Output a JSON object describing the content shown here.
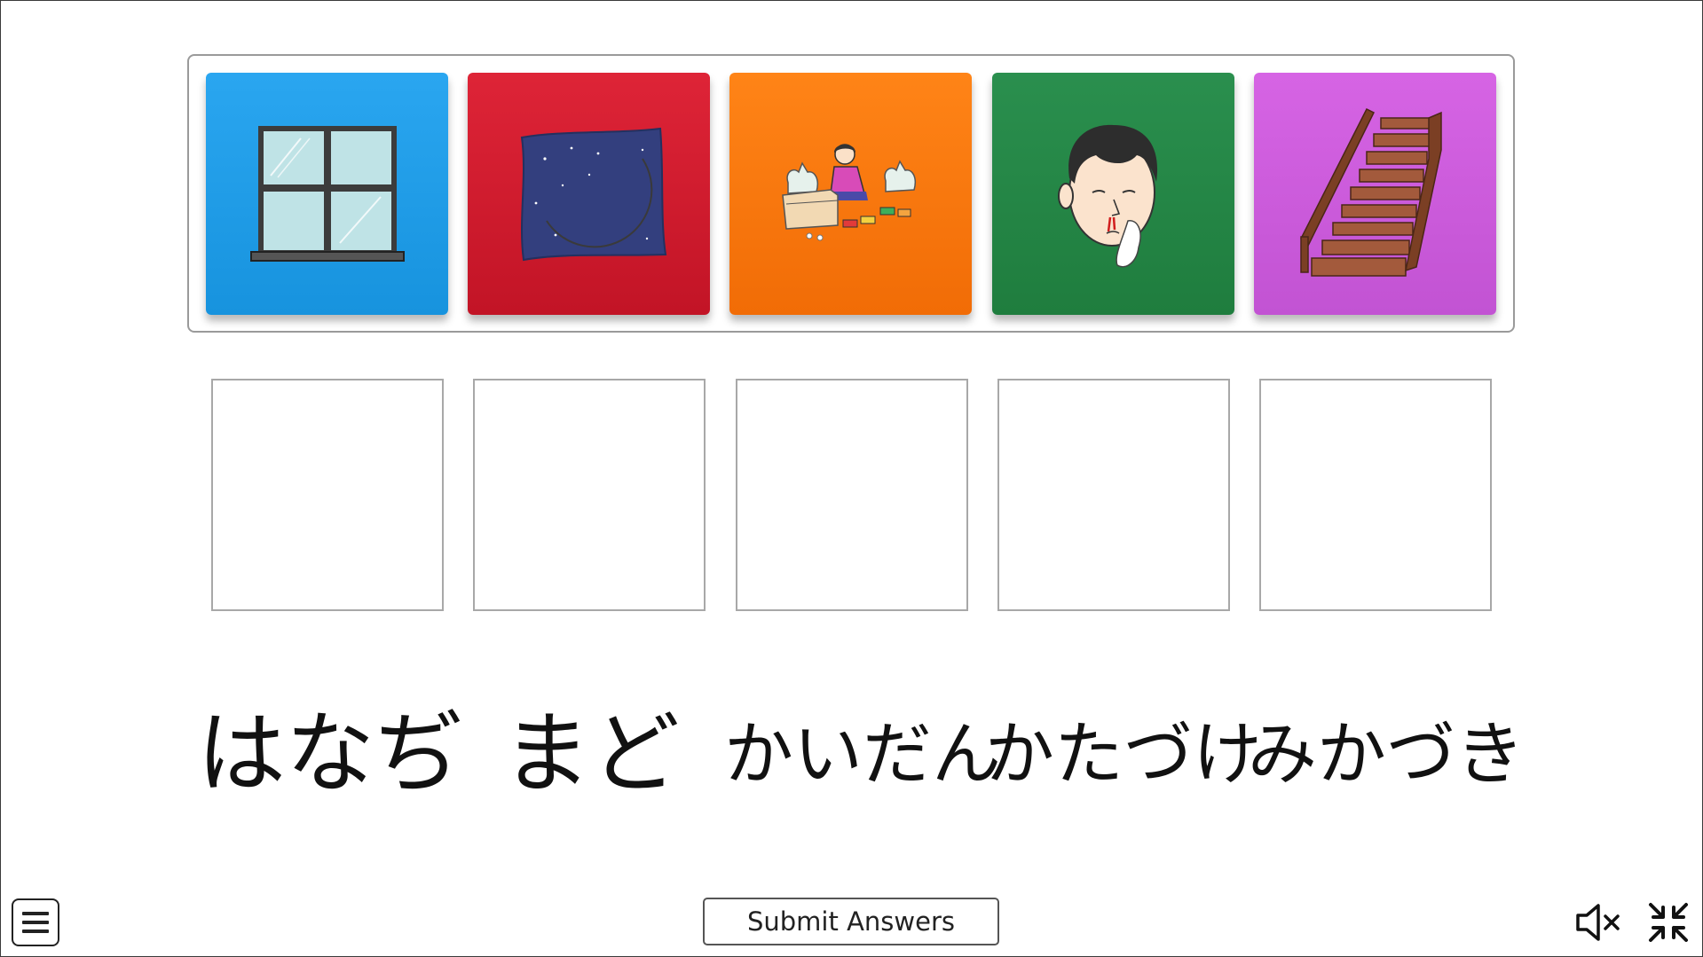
{
  "tiles": [
    {
      "icon": "window-icon",
      "color": "#1f9ce8"
    },
    {
      "icon": "crescent-moon-night-icon",
      "color": "#d01c2e"
    },
    {
      "icon": "child-tidying-up-icon",
      "color": "#f97810"
    },
    {
      "icon": "nosebleed-face-icon",
      "color": "#258746"
    },
    {
      "icon": "staircase-icon",
      "color": "#cc5cdc"
    }
  ],
  "slots_count": 5,
  "words": {
    "w1": "はなぢ",
    "w2": "まど",
    "w3": "かいだん",
    "w4": "かたづけ",
    "w5": "みかづき"
  },
  "controls": {
    "submit_label": "Submit Answers",
    "menu_icon": "hamburger-menu-icon",
    "mute_icon": "speaker-muted-icon",
    "fullscreen_icon": "exit-fullscreen-icon"
  }
}
